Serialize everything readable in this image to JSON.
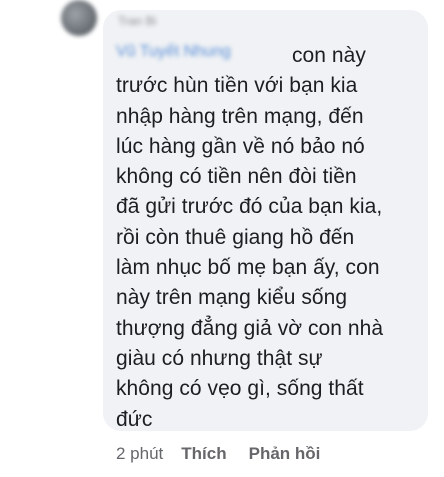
{
  "comment": {
    "author_name": "Tran Bi",
    "mention": "Vũ Tuyết Nhung",
    "lines": [
      "con này",
      "trước hùn tiền với bạn kia",
      "nhập hàng trên mạng, đến",
      "lúc hàng gần về nó bảo nó",
      "không có tiền nên đòi tiền",
      "đã gửi trước đó của bạn kia,",
      "rồi còn thuê giang hồ đến",
      "làm nhục bố mẹ bạn ấy, con",
      "này trên mạng kiểu sống",
      "thượng đẳng giả vờ con nhà",
      "giàu có nhưng thật sự",
      "không có vẹo gì, sống thất",
      "đức"
    ]
  },
  "actions": {
    "time": "2 phút",
    "like_label": "Thích",
    "reply_label": "Phản hồi"
  }
}
